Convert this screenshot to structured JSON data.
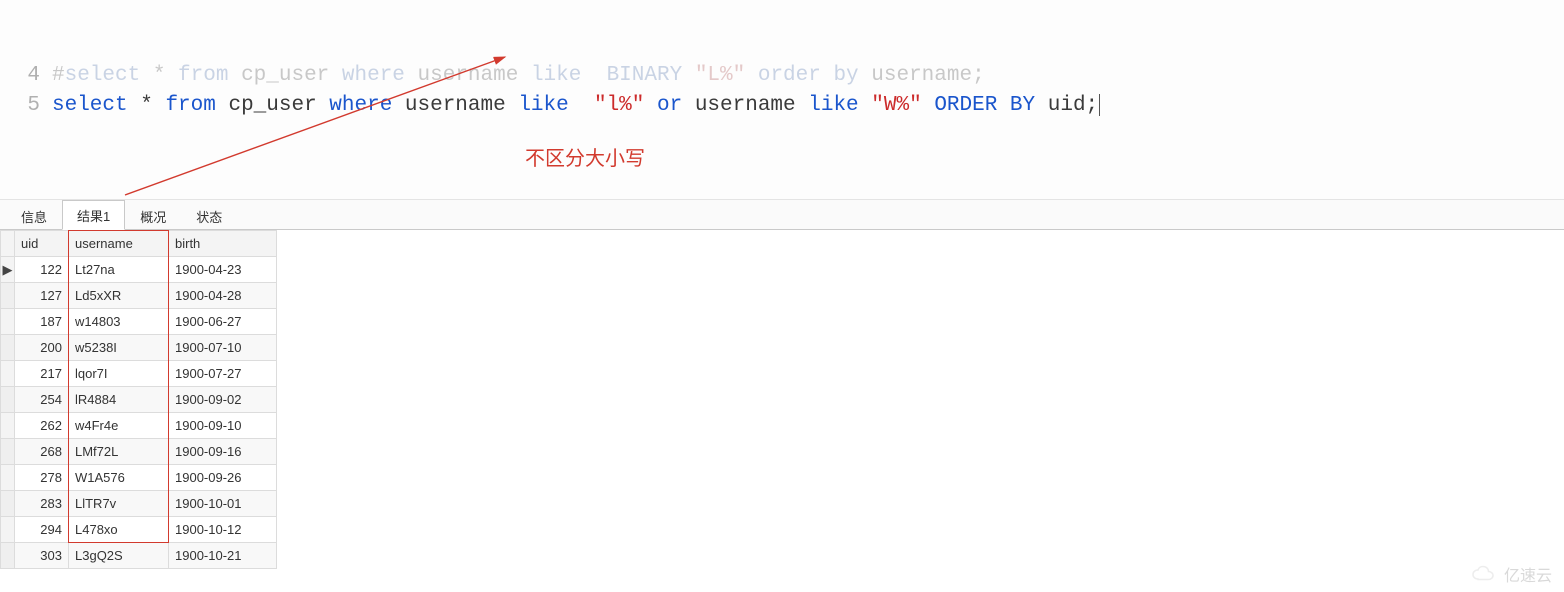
{
  "editor": {
    "lines": [
      {
        "num": "4",
        "faded": true,
        "tokens": [
          {
            "t": "#",
            "c": "plain"
          },
          {
            "t": "select",
            "c": "kw"
          },
          {
            "t": " * ",
            "c": "plain"
          },
          {
            "t": "from",
            "c": "kw"
          },
          {
            "t": " cp_user ",
            "c": "plain"
          },
          {
            "t": "where",
            "c": "kw"
          },
          {
            "t": " username ",
            "c": "plain"
          },
          {
            "t": "like",
            "c": "kw"
          },
          {
            "t": "  ",
            "c": "plain"
          },
          {
            "t": "BINARY",
            "c": "kw"
          },
          {
            "t": " ",
            "c": "plain"
          },
          {
            "t": "\"L%\"",
            "c": "str"
          },
          {
            "t": " ",
            "c": "plain"
          },
          {
            "t": "order by",
            "c": "kw"
          },
          {
            "t": " username;",
            "c": "plain"
          }
        ]
      },
      {
        "num": "5",
        "faded": false,
        "tokens": [
          {
            "t": "select",
            "c": "kw"
          },
          {
            "t": " * ",
            "c": "plain"
          },
          {
            "t": "from",
            "c": "kw"
          },
          {
            "t": " cp_user ",
            "c": "plain"
          },
          {
            "t": "where",
            "c": "kw"
          },
          {
            "t": " username ",
            "c": "plain"
          },
          {
            "t": "like",
            "c": "kw"
          },
          {
            "t": "  ",
            "c": "plain"
          },
          {
            "t": "\"l%\"",
            "c": "str"
          },
          {
            "t": " ",
            "c": "plain"
          },
          {
            "t": "or",
            "c": "kw"
          },
          {
            "t": " username ",
            "c": "plain"
          },
          {
            "t": "like",
            "c": "kw"
          },
          {
            "t": " ",
            "c": "plain"
          },
          {
            "t": "\"W%\"",
            "c": "str"
          },
          {
            "t": " ",
            "c": "plain"
          },
          {
            "t": "ORDER BY",
            "c": "kw"
          },
          {
            "t": " uid;",
            "c": "plain"
          }
        ]
      }
    ]
  },
  "annotation_text": "不区分大小写",
  "tabs": {
    "items": [
      "信息",
      "结果1",
      "概况",
      "状态"
    ],
    "active_index": 1
  },
  "grid": {
    "columns": [
      "uid",
      "username",
      "birth"
    ],
    "rows": [
      {
        "uid": "122",
        "username": "Lt27na",
        "birth": "1900-04-23",
        "current": true
      },
      {
        "uid": "127",
        "username": "Ld5xXR",
        "birth": "1900-04-28"
      },
      {
        "uid": "187",
        "username": "w14803",
        "birth": "1900-06-27"
      },
      {
        "uid": "200",
        "username": "w5238I",
        "birth": "1900-07-10"
      },
      {
        "uid": "217",
        "username": "lqor7I",
        "birth": "1900-07-27"
      },
      {
        "uid": "254",
        "username": "lR4884",
        "birth": "1900-09-02"
      },
      {
        "uid": "262",
        "username": "w4Fr4e",
        "birth": "1900-09-10"
      },
      {
        "uid": "268",
        "username": "LMf72L",
        "birth": "1900-09-16"
      },
      {
        "uid": "278",
        "username": "W1A576",
        "birth": "1900-09-26"
      },
      {
        "uid": "283",
        "username": "LlTR7v",
        "birth": "1900-10-01"
      },
      {
        "uid": "294",
        "username": "L478xo",
        "birth": "1900-10-12"
      },
      {
        "uid": "303",
        "username": "L3gQ2S",
        "birth": "1900-10-21"
      }
    ]
  },
  "watermark": "亿速云",
  "colors": {
    "annotation": "#d23a2e",
    "keyword": "#1a55cc",
    "string": "#cc2b2b"
  }
}
